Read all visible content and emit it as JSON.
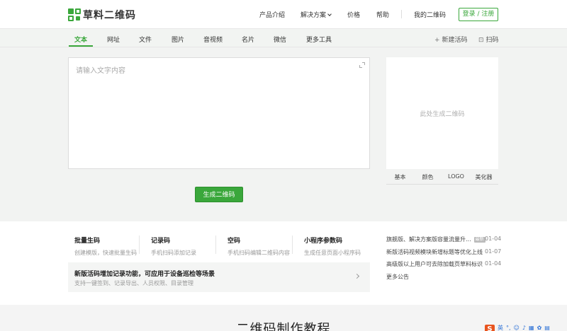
{
  "header": {
    "logo_text": "草料二维码",
    "nav": [
      {
        "label": "产品介绍"
      },
      {
        "label": "解决方案"
      },
      {
        "label": "价格"
      },
      {
        "label": "帮助"
      },
      {
        "label": "我的二维码"
      }
    ],
    "login_label": "登录 / 注册"
  },
  "tabs": {
    "items": [
      "文本",
      "网址",
      "文件",
      "图片",
      "音视频",
      "名片",
      "微信",
      "更多工具"
    ],
    "active": "文本",
    "new_dynamic": "新建活码",
    "scan": "扫码"
  },
  "editor": {
    "placeholder": "请输入文字内容",
    "generate_label": "生成二维码"
  },
  "qr_preview": {
    "placeholder": "此处生成二维码",
    "style_tabs": [
      "基本",
      "颜色",
      "LOGO",
      "美化器"
    ]
  },
  "features": [
    {
      "title": "批量生码",
      "subtitle": "创建模版，快速批量生码"
    },
    {
      "title": "记录码",
      "subtitle": "手机扫码添加记录"
    },
    {
      "title": "空码",
      "subtitle": "手机扫码编辑二维码内容"
    },
    {
      "title": "小程序参数码",
      "subtitle": "生成任意页面小程序码"
    }
  ],
  "promo": {
    "title": "新版活码增加记录功能，可应用于设备巡检等场景",
    "subtitle": "支持一键签到、记录导出、人员权限、目录管理"
  },
  "news": [
    {
      "text": "旗舰版、解决方案版容量流量升...",
      "badge": "最新",
      "date": "01-04"
    },
    {
      "text": "新版活码视频模块新增标题等优化上线",
      "date": "01-07"
    },
    {
      "text": "高级版以上用户可去除加载页草料标识",
      "date": "01-04"
    }
  ],
  "more_news": "更多公告",
  "tutorial_title": "二维码制作教程",
  "ime": {
    "logo": "S",
    "lang": "英"
  }
}
